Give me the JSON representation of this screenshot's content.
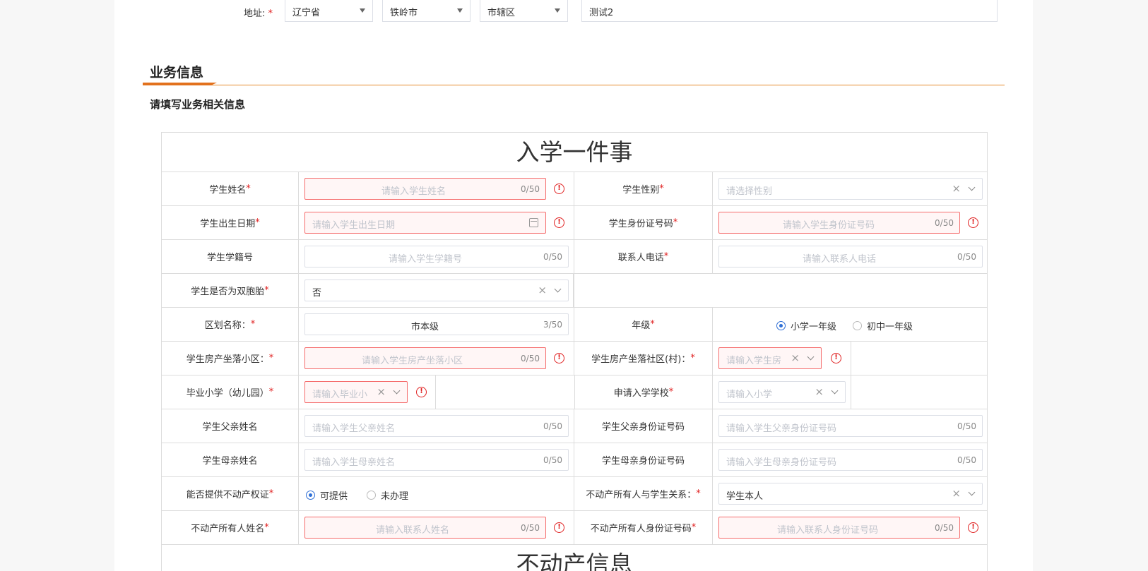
{
  "address": {
    "label": "地址:",
    "required": "*",
    "province": "辽宁省",
    "city": "铁岭市",
    "district": "市辖区",
    "detail": "测试2"
  },
  "section": {
    "title": "业务信息",
    "subtitle": "请填写业务相关信息"
  },
  "form": {
    "title": "入学一件事",
    "next_title": "不动产信息",
    "required_mark": "*",
    "counter_empty": "0/50",
    "counter_filled": "3/50",
    "student_name": {
      "label": "学生姓名",
      "placeholder": "请输入学生姓名"
    },
    "student_gender": {
      "label": "学生性别",
      "placeholder": "请选择性别"
    },
    "birth_date": {
      "label": "学生出生日期",
      "placeholder": "请输入学生出生日期"
    },
    "id_number": {
      "label": "学生身份证号码",
      "placeholder": "请输入学生身份证号码"
    },
    "student_no": {
      "label": "学生学籍号",
      "placeholder": "请输入学生学籍号"
    },
    "contact_phone": {
      "label": "联系人电话",
      "placeholder": "请输入联系人电话"
    },
    "twins": {
      "label": "学生是否为双胞胎",
      "value": "否"
    },
    "district_name": {
      "label": "区划名称：",
      "value": "市本级"
    },
    "grade": {
      "label": "年级",
      "options": [
        "小学一年级",
        "初中一年级"
      ],
      "selected": 0
    },
    "property_community": {
      "label": "学生房产坐落小区：",
      "placeholder": "请输入学生房产坐落小区"
    },
    "property_village": {
      "label": "学生房产坐落社区(村)：",
      "placeholder": "请输入学生房"
    },
    "graduate_school": {
      "label": "毕业小学（幼儿园）",
      "placeholder": "请输入毕业小"
    },
    "apply_school": {
      "label": "申请入学学校",
      "placeholder": "请输入小学"
    },
    "father_name": {
      "label": "学生父亲姓名",
      "placeholder": "请输入学生父亲姓名"
    },
    "father_id": {
      "label": "学生父亲身份证号码",
      "placeholder": "请输入学生父亲身份证号码"
    },
    "mother_name": {
      "label": "学生母亲姓名",
      "placeholder": "请输入学生母亲姓名"
    },
    "mother_id": {
      "label": "学生母亲身份证号码",
      "placeholder": "请输入学生母亲身份证号码"
    },
    "property_cert": {
      "label": "能否提供不动产权证",
      "options": [
        "可提供",
        "未办理"
      ],
      "selected": 0
    },
    "owner_relation": {
      "label": "不动产所有人与学生关系：",
      "value": "学生本人"
    },
    "owner_name": {
      "label": "不动产所有人姓名",
      "placeholder": "请输入联系人姓名"
    },
    "owner_id": {
      "label": "不动产所有人身份证号码",
      "placeholder": "请输入联系人身份证号码"
    }
  },
  "icons": {
    "clear": "×",
    "error": "!"
  }
}
